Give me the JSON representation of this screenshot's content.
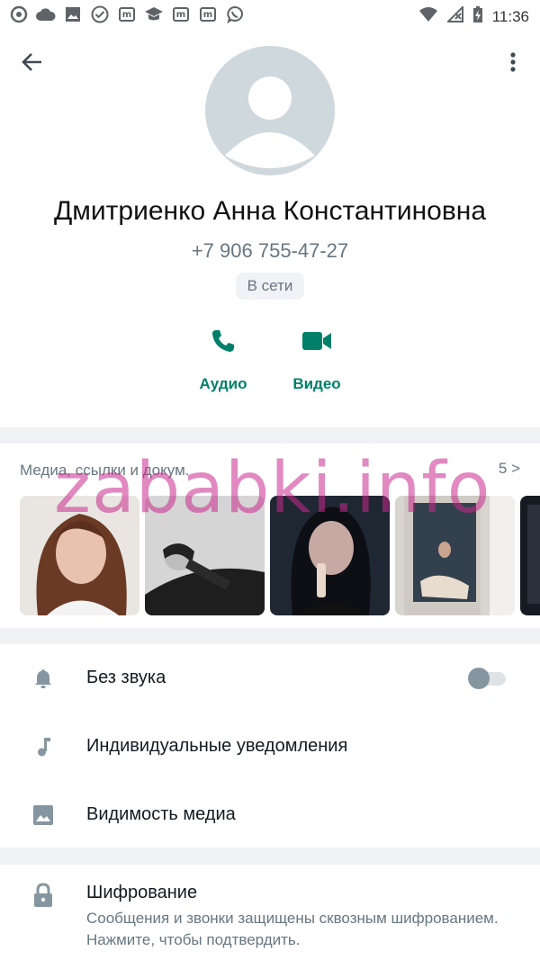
{
  "status_bar": {
    "time": "11:36",
    "left_icons": [
      "at-icon",
      "cloud-icon",
      "image-icon",
      "check-circle-icon",
      "m-icon",
      "graduation-icon",
      "m-icon",
      "m-icon",
      "viber-icon"
    ],
    "right_icons": [
      "wifi-icon",
      "no-signal-icon",
      "battery-charging-icon"
    ]
  },
  "contact": {
    "name": "Дмитриенко Анна Константиновна",
    "phone": "+7 906 755-47-27",
    "status": "В сети"
  },
  "actions": {
    "audio_label": "Аудио",
    "video_label": "Видео"
  },
  "media": {
    "title": "Медиа, ссылки и докум.",
    "count": "5 >"
  },
  "watermark": "zababki.info",
  "settings": {
    "mute_label": "Без звука",
    "mute_on": false,
    "custom_notifications_label": "Индивидуальные уведомления",
    "media_visibility_label": "Видимость медиа"
  },
  "encryption": {
    "title": "Шифрование",
    "subtitle": "Сообщения и звонки защищены сквозным шифрованием. Нажмите, чтобы подтвердить."
  },
  "colors": {
    "accent": "#008069",
    "muted_text": "#667781",
    "background": "#f0f2f5"
  }
}
